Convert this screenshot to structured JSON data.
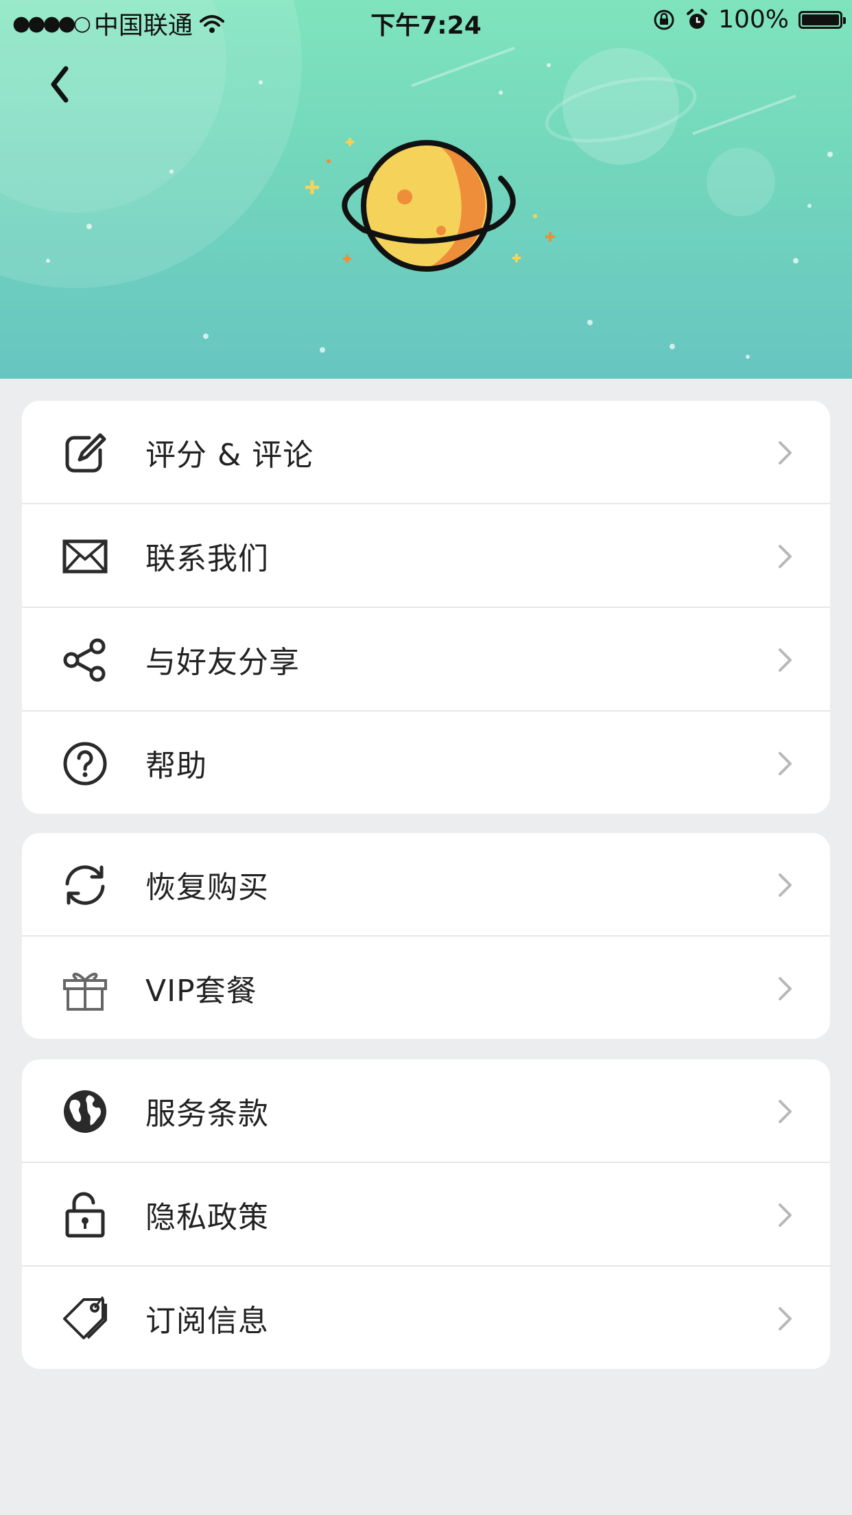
{
  "status_bar": {
    "signal_dots": "●●●●○",
    "carrier": "中国联通",
    "time": "下午7:24",
    "battery_percent": "100%"
  },
  "header": {
    "back_icon": "chevron-left-icon",
    "illustration": "planet-icon",
    "colors": {
      "top": "#7fe4bd",
      "bottom": "#67c5c1"
    }
  },
  "menu": {
    "group1": [
      {
        "label": "评分 & 评论",
        "icon": "edit-icon"
      },
      {
        "label": "联系我们",
        "icon": "mail-icon"
      },
      {
        "label": "与好友分享",
        "icon": "share-icon"
      },
      {
        "label": "帮助",
        "icon": "help-icon"
      }
    ],
    "group2": [
      {
        "label": "恢复购买",
        "icon": "refresh-icon"
      },
      {
        "label": "VIP套餐",
        "icon": "gift-icon"
      }
    ],
    "group3": [
      {
        "label": "服务条款",
        "icon": "globe-icon"
      },
      {
        "label": "隐私政策",
        "icon": "lock-icon"
      },
      {
        "label": "订阅信息",
        "icon": "tag-icon"
      }
    ]
  }
}
